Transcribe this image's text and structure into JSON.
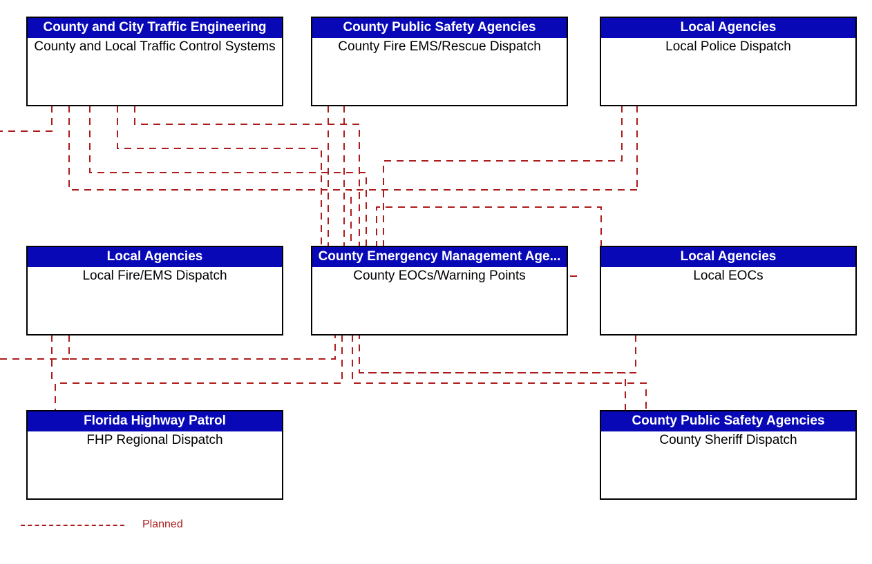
{
  "colors": {
    "header_bg": "#0808b7",
    "header_fg": "#ffffff",
    "border": "#000000",
    "connector": "#ac1c1c",
    "legend_text": "#ac1c1c"
  },
  "nodes": {
    "top_left": {
      "header": "County and City Traffic Engineering",
      "body": "County and Local Traffic Control Systems"
    },
    "top_center": {
      "header": "County Public Safety Agencies",
      "body": "County Fire EMS/Rescue Dispatch"
    },
    "top_right": {
      "header": "Local Agencies",
      "body": "Local Police Dispatch"
    },
    "mid_left": {
      "header": "Local Agencies",
      "body": "Local Fire/EMS Dispatch"
    },
    "mid_center": {
      "header": "County Emergency Management Age...",
      "body": "County EOCs/Warning Points"
    },
    "mid_right": {
      "header": "Local Agencies",
      "body": "Local EOCs"
    },
    "bot_left": {
      "header": "Florida Highway Patrol",
      "body": "FHP Regional Dispatch"
    },
    "bot_right": {
      "header": "County Public Safety Agencies",
      "body": "County Sheriff Dispatch"
    }
  },
  "legend": {
    "label": "Planned"
  }
}
